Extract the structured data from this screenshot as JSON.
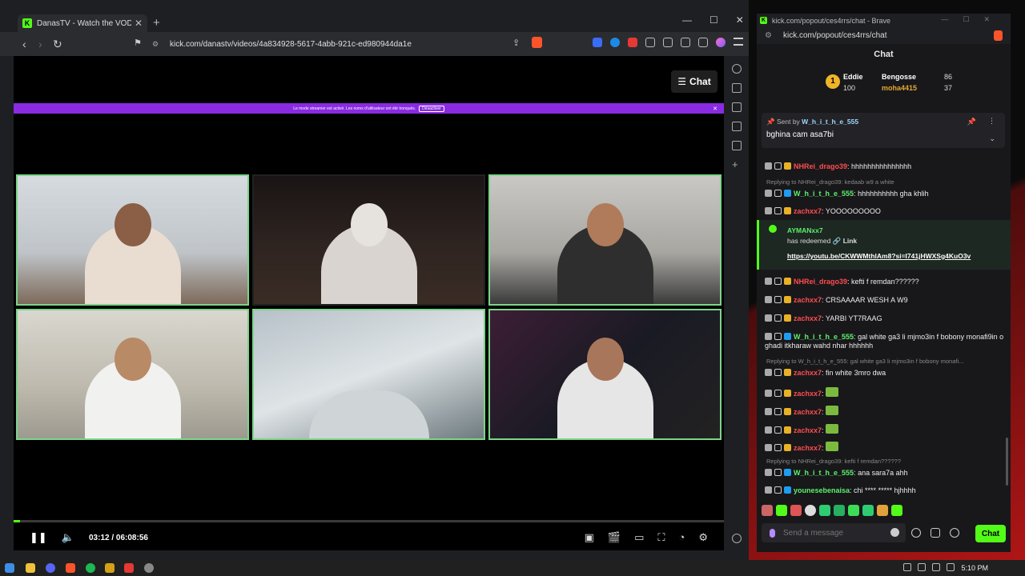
{
  "left_window": {
    "tab_title": "DanasTV - Watch the VOD on Kick",
    "url": "kick.com/danastv/videos/4a834928-5617-4abb-921c-ed980944da1e",
    "chat_toggle_label": "Chat",
    "banner_text": "Le mode streamer est activé. Les noms d'utilisateur ont été tronqués.",
    "banner_button": "Désactiver",
    "time_current": "03:12",
    "time_separator": "/",
    "time_total": "06:08:56",
    "progress_fraction": 0.009
  },
  "right_window": {
    "title": "kick.com/popout/ces4rrs/chat - Brave",
    "url": "kick.com/popout/ces4rrs/chat",
    "header": "Chat",
    "leaderboard": {
      "rank": "1",
      "first_name": "Eddie",
      "first_points": "100",
      "second_name": "Bengosse",
      "second_points": "86",
      "third_name": "moha4415",
      "third_points": "37"
    },
    "pinned": {
      "sent_by_label": "Sent by",
      "sender": "W_h_i_t_h_e_555",
      "message": "bghina cam asa7bi"
    },
    "messages": [
      {
        "user": "NHRei_drago39",
        "color": "#ff4d4d",
        "text": "hhhhhhhhhhhhhhh"
      },
      {
        "reply": "Replying to NHRei_drago39: kedaab w9 a white"
      },
      {
        "user": "W_h_i_t_h_e_555",
        "color": "#5ef06b",
        "text": "hhhhhhhhhh gha khlih"
      },
      {
        "user": "zachxx7",
        "color": "#ff4d4d",
        "text": "YOOOOOOOOO"
      },
      {
        "user": "NHRei_drago39",
        "color": "#ff4d4d",
        "text": "kefti f remdan??????"
      },
      {
        "user": "zachxx7",
        "color": "#ff4d4d",
        "text": "CRSAAAAR WESH A W9"
      },
      {
        "user": "zachxx7",
        "color": "#ff4d4d",
        "text": "YARBI YT7RAAG"
      },
      {
        "user": "W_h_i_t_h_e_555",
        "color": "#5ef06b",
        "text": "gal white ga3 li mjmo3in f bobony monafi9in o ghadi itkharaw wahd nhar hhhhhh"
      },
      {
        "reply": "Replying to W_h_i_t_h_e_555: gal white ga3 li mjmo3in f bobony monafi..."
      },
      {
        "user": "zachxx7",
        "color": "#ff4d4d",
        "text": "fin white 3mro dwa"
      },
      {
        "user": "zachxx7",
        "color": "#ff4d4d",
        "text": ""
      },
      {
        "user": "zachxx7",
        "color": "#ff4d4d",
        "text": ""
      },
      {
        "user": "zachxx7",
        "color": "#ff4d4d",
        "text": ""
      },
      {
        "user": "zachxx7",
        "color": "#ff4d4d",
        "text": ""
      },
      {
        "reply": "Replying to NHRei_drago39: kefti f remdan??????"
      },
      {
        "user": "W_h_i_t_h_e_555",
        "color": "#5ef06b",
        "text": "ana sara7a ahh"
      },
      {
        "user": "younesebenaisa",
        "color": "#5ef06b",
        "text": "chi **** ***** hjhhhh"
      }
    ],
    "redeem": {
      "user": "AYMANxx7",
      "text": "has redeemed",
      "link_label": "Link",
      "link": "https://youtu.be/CKWWMthlAm8?si=I741jHWXSg4KuO3v"
    },
    "input_placeholder": "Send a message",
    "send_label": "Chat"
  },
  "taskbar": {
    "clock": "5:10 PM"
  },
  "colors": {
    "kick_green": "#53fc18",
    "banner_purple": "#8a2be2"
  }
}
